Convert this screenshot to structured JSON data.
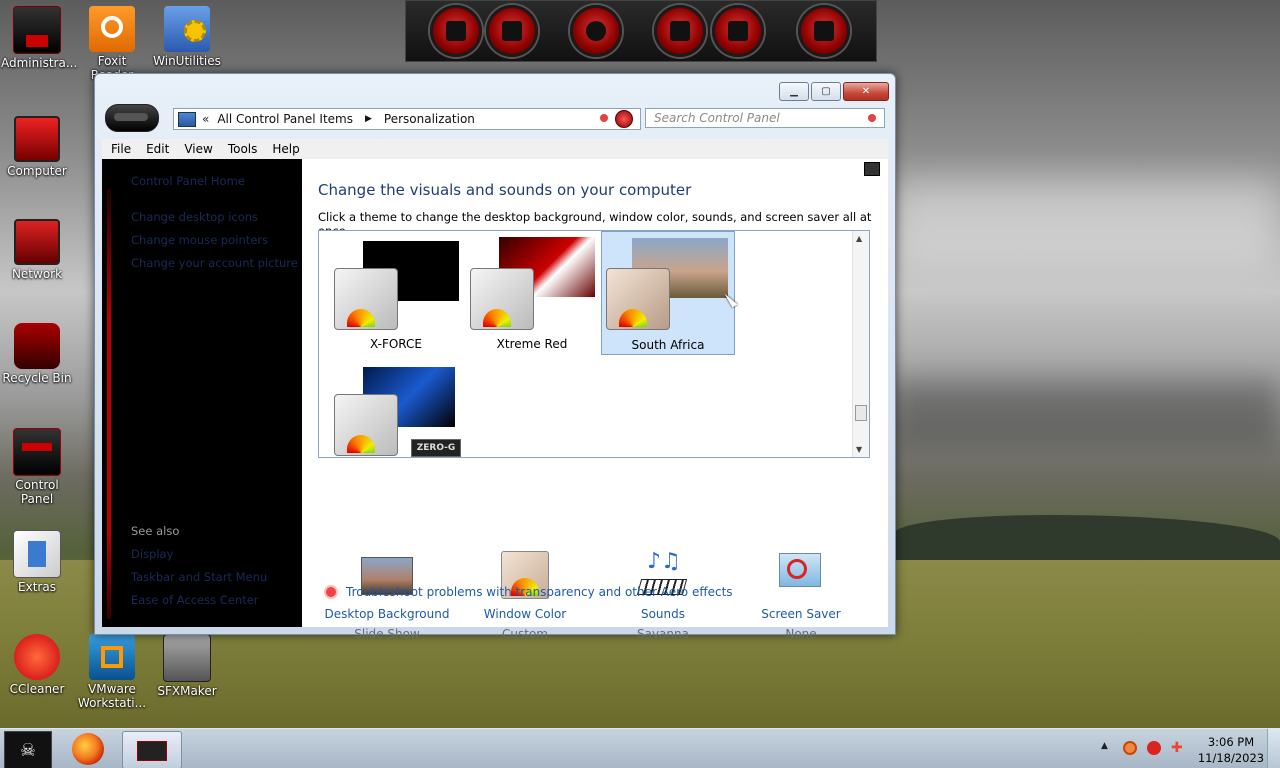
{
  "desktop": {
    "icons": [
      {
        "label": "Administra...",
        "icon": "administrator-icon"
      },
      {
        "label": "Foxit Reader",
        "icon": "foxit-reader-icon"
      },
      {
        "label": "WinUtilities",
        "icon": "winutilities-icon"
      },
      {
        "label": "Computer",
        "icon": "computer-icon"
      },
      {
        "label": "Network",
        "icon": "network-icon"
      },
      {
        "label": "Recycle Bin",
        "icon": "recycle-bin-icon"
      },
      {
        "label": "Control Panel",
        "icon": "control-panel-icon"
      },
      {
        "label": "Extras",
        "icon": "extras-icon"
      },
      {
        "label": "CCleaner",
        "icon": "ccleaner-icon"
      },
      {
        "label": "VMware Workstati...",
        "icon": "vmware-icon"
      },
      {
        "label": "SFXMaker",
        "icon": "sfxmaker-icon"
      }
    ]
  },
  "window": {
    "breadcrumb": {
      "chevrons": "«",
      "item1": "All Control Panel Items",
      "item2": "Personalization"
    },
    "search_placeholder": "Search Control Panel",
    "menu": [
      "File",
      "Edit",
      "View",
      "Tools",
      "Help"
    ],
    "left_nav": {
      "home": "Control Panel Home",
      "links": [
        "Change desktop icons",
        "Change mouse pointers",
        "Change your account picture"
      ],
      "see_also_title": "See also",
      "see_also": [
        "Display",
        "Taskbar and Start Menu",
        "Ease of Access Center"
      ]
    },
    "heading": "Change the visuals and sounds on your computer",
    "subheading": "Click a theme to change the desktop background, window color, sounds, and screen saver all at once.",
    "themes": [
      {
        "name": "X-FORCE",
        "selected": false
      },
      {
        "name": "Xtreme Red",
        "selected": false
      },
      {
        "name": "South Africa",
        "selected": true
      },
      {
        "name": "",
        "badge": "ZERO-G",
        "selected": false
      }
    ],
    "settings": [
      {
        "label": "Desktop Background",
        "value": "Slide Show",
        "icon": "desktop-background-icon"
      },
      {
        "label": "Window Color",
        "value": "Custom",
        "icon": "window-color-icon"
      },
      {
        "label": "Sounds",
        "value": "Savanna",
        "icon": "sounds-icon"
      },
      {
        "label": "Screen Saver",
        "value": "None",
        "icon": "screen-saver-icon"
      }
    ],
    "troubleshoot": "Troubleshoot problems with transparency and other Aero effects"
  },
  "taskbar": {
    "clock_time": "3:06 PM",
    "clock_date": "11/18/2023"
  },
  "colors": {
    "link": "#1e5aa8",
    "heading": "#1e3d78",
    "selected_theme_bg": "#cde4fa"
  }
}
